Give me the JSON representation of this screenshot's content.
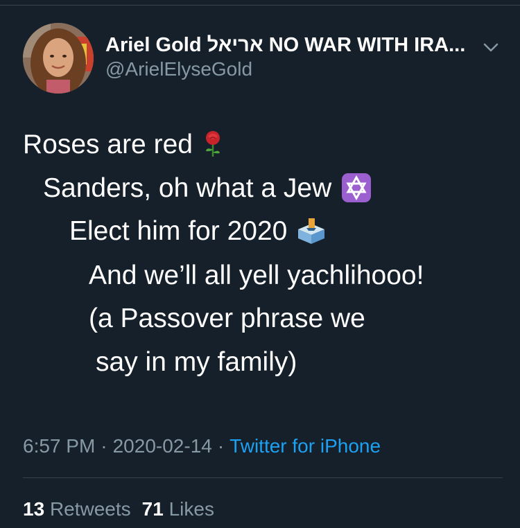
{
  "author": {
    "display_name": "Ariel Gold אריאל NO WAR WITH IRA...",
    "handle": "@ArielElyseGold"
  },
  "tweet": {
    "lines": [
      "Roses are red",
      "Sanders, oh what a Jew",
      "Elect him for 2020",
      "And we’ll all yell yachlihooo!",
      "(a Passover phrase we",
      "say in my family)"
    ],
    "emojis": [
      "rose-icon",
      "star-of-david-icon",
      "ballot-box-icon"
    ]
  },
  "meta": {
    "time": "6:57 PM",
    "separator": "·",
    "date": "2020-02-14",
    "source": "Twitter for iPhone"
  },
  "stats": {
    "retweets_count": "13",
    "retweets_label": "Retweets",
    "likes_count": "71",
    "likes_label": "Likes"
  },
  "colors": {
    "background": "#15202b",
    "text": "#ffffff",
    "muted": "#8899a6",
    "link": "#1da1f2",
    "divider": "#38444d"
  }
}
